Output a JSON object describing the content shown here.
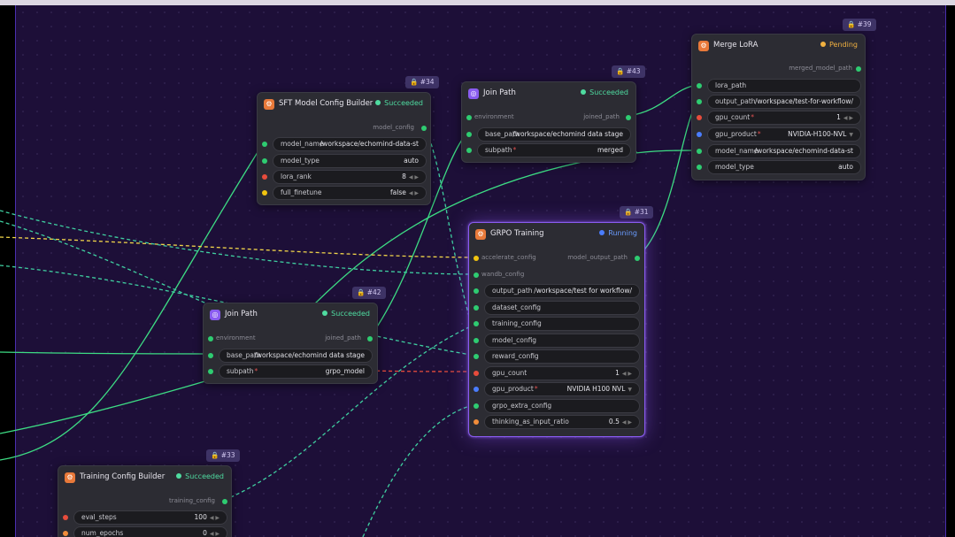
{
  "nodes": {
    "merge_lora": {
      "id": "#39",
      "title": "Merge LoRA",
      "status": "Pending",
      "output": "merged_model_path",
      "fields": [
        "lora_path",
        "output_path",
        "gpu_count",
        "gpu_product",
        "model_name",
        "model_type"
      ],
      "values": {
        "output_path": "/workspace/test-for-workflow/",
        "gpu_count": "1",
        "gpu_product": "NVIDIA-H100-NVL",
        "model_name": "/workspace/echomind-data-st",
        "model_type": "auto"
      }
    },
    "join_path_43": {
      "id": "#43",
      "title": "Join Path",
      "status": "Succeeded",
      "input": "environment",
      "output": "joined_path",
      "fields": [
        "base_path",
        "subpath"
      ],
      "values": {
        "base_path": "/workspace/echomind data stage",
        "subpath": "merged"
      }
    },
    "sft_config": {
      "id": "#34",
      "title": "SFT Model Config Builder",
      "status": "Succeeded",
      "output": "model_config",
      "fields": [
        "model_name",
        "model_type",
        "lora_rank",
        "full_finetune"
      ],
      "values": {
        "model_name": "/workspace/echomind-data-st",
        "model_type": "auto",
        "lora_rank": "8",
        "full_finetune": "false"
      }
    },
    "grpo": {
      "id": "#31",
      "title": "GRPO Training",
      "status": "Running",
      "output": "model_output_path",
      "inputs": [
        "accelerate_config",
        "wandb_config"
      ],
      "fields": [
        "output_path",
        "dataset_config",
        "training_config",
        "model_config",
        "reward_config",
        "gpu_count",
        "gpu_product",
        "grpo_extra_config",
        "thinking_as_input_ratio"
      ],
      "values": {
        "output_path": "/workspace/test for workflow/",
        "gpu_count": "1",
        "gpu_product": "NVIDIA H100 NVL",
        "thinking_as_input_ratio": "0.5"
      }
    },
    "join_path_42": {
      "id": "#42",
      "title": "Join Path",
      "status": "Succeeded",
      "input": "environment",
      "output": "joined_path",
      "fields": [
        "base_path",
        "subpath"
      ],
      "values": {
        "base_path": "/workspace/echomind data stage",
        "subpath": "grpo_model"
      }
    },
    "training_config": {
      "id": "#33",
      "title": "Training Config Builder",
      "status": "Succeeded",
      "output": "training_config",
      "fields": [
        "eval_steps",
        "num_epochs"
      ],
      "values": {
        "eval_steps": "100",
        "num_epochs": "0"
      }
    }
  },
  "colors": {
    "canvas": "#1d0f38",
    "node": "#2c2c33",
    "running_glow": "#8a5cf0",
    "edge_green": "#3ddc84",
    "edge_yellow": "#f1d54a",
    "edge_red": "#e74c3c",
    "edge_teal": "#3fcfa0"
  },
  "icons": {
    "node": "gear-icon",
    "join": "link-icon",
    "lock": "lock-icon",
    "dropdown": "chevron-down-icon",
    "stepper": "stepper-arrows-icon"
  }
}
